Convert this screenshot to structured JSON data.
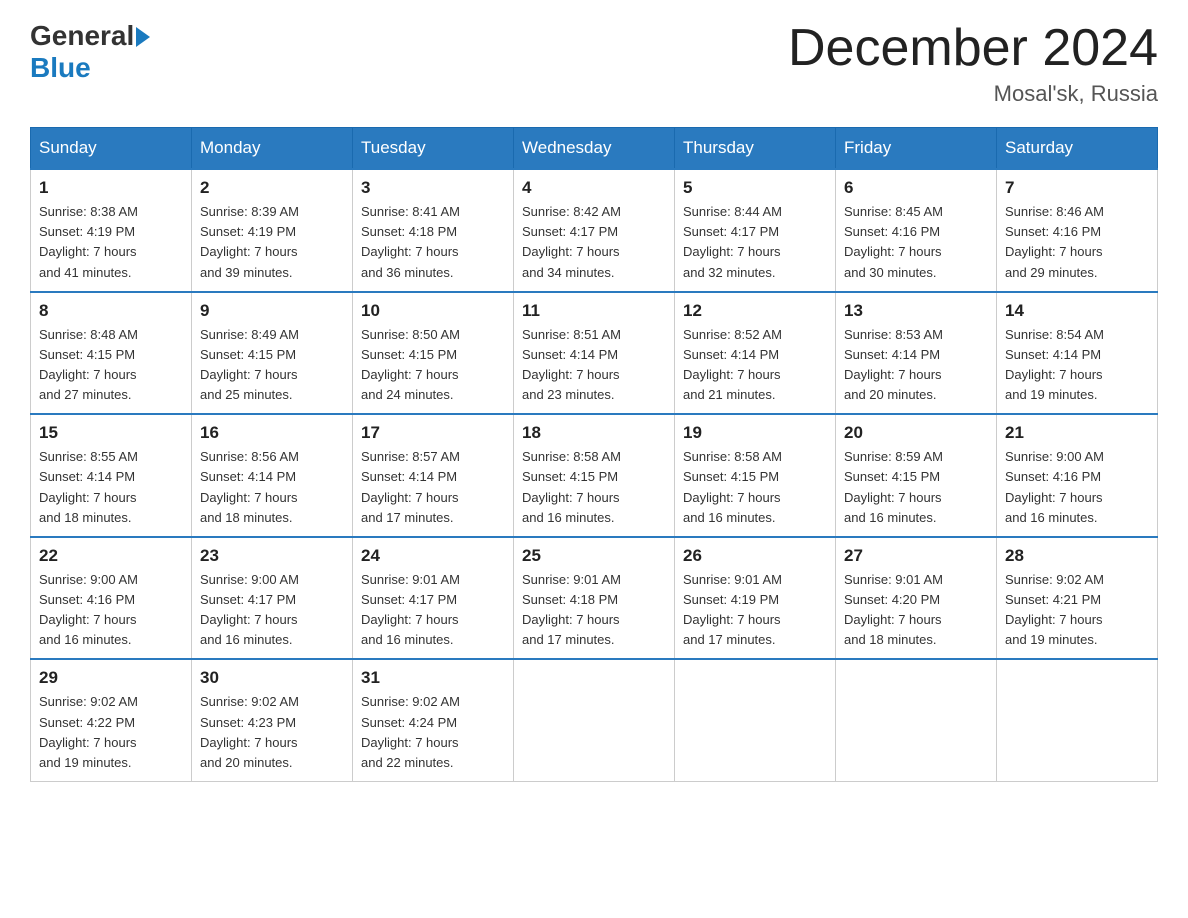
{
  "logo": {
    "general": "General",
    "blue": "Blue"
  },
  "title": "December 2024",
  "location": "Mosal'sk, Russia",
  "weekdays": [
    "Sunday",
    "Monday",
    "Tuesday",
    "Wednesday",
    "Thursday",
    "Friday",
    "Saturday"
  ],
  "weeks": [
    [
      {
        "day": "1",
        "sunrise": "8:38 AM",
        "sunset": "4:19 PM",
        "daylight": "7 hours and 41 minutes."
      },
      {
        "day": "2",
        "sunrise": "8:39 AM",
        "sunset": "4:19 PM",
        "daylight": "7 hours and 39 minutes."
      },
      {
        "day": "3",
        "sunrise": "8:41 AM",
        "sunset": "4:18 PM",
        "daylight": "7 hours and 36 minutes."
      },
      {
        "day": "4",
        "sunrise": "8:42 AM",
        "sunset": "4:17 PM",
        "daylight": "7 hours and 34 minutes."
      },
      {
        "day": "5",
        "sunrise": "8:44 AM",
        "sunset": "4:17 PM",
        "daylight": "7 hours and 32 minutes."
      },
      {
        "day": "6",
        "sunrise": "8:45 AM",
        "sunset": "4:16 PM",
        "daylight": "7 hours and 30 minutes."
      },
      {
        "day": "7",
        "sunrise": "8:46 AM",
        "sunset": "4:16 PM",
        "daylight": "7 hours and 29 minutes."
      }
    ],
    [
      {
        "day": "8",
        "sunrise": "8:48 AM",
        "sunset": "4:15 PM",
        "daylight": "7 hours and 27 minutes."
      },
      {
        "day": "9",
        "sunrise": "8:49 AM",
        "sunset": "4:15 PM",
        "daylight": "7 hours and 25 minutes."
      },
      {
        "day": "10",
        "sunrise": "8:50 AM",
        "sunset": "4:15 PM",
        "daylight": "7 hours and 24 minutes."
      },
      {
        "day": "11",
        "sunrise": "8:51 AM",
        "sunset": "4:14 PM",
        "daylight": "7 hours and 23 minutes."
      },
      {
        "day": "12",
        "sunrise": "8:52 AM",
        "sunset": "4:14 PM",
        "daylight": "7 hours and 21 minutes."
      },
      {
        "day": "13",
        "sunrise": "8:53 AM",
        "sunset": "4:14 PM",
        "daylight": "7 hours and 20 minutes."
      },
      {
        "day": "14",
        "sunrise": "8:54 AM",
        "sunset": "4:14 PM",
        "daylight": "7 hours and 19 minutes."
      }
    ],
    [
      {
        "day": "15",
        "sunrise": "8:55 AM",
        "sunset": "4:14 PM",
        "daylight": "7 hours and 18 minutes."
      },
      {
        "day": "16",
        "sunrise": "8:56 AM",
        "sunset": "4:14 PM",
        "daylight": "7 hours and 18 minutes."
      },
      {
        "day": "17",
        "sunrise": "8:57 AM",
        "sunset": "4:14 PM",
        "daylight": "7 hours and 17 minutes."
      },
      {
        "day": "18",
        "sunrise": "8:58 AM",
        "sunset": "4:15 PM",
        "daylight": "7 hours and 16 minutes."
      },
      {
        "day": "19",
        "sunrise": "8:58 AM",
        "sunset": "4:15 PM",
        "daylight": "7 hours and 16 minutes."
      },
      {
        "day": "20",
        "sunrise": "8:59 AM",
        "sunset": "4:15 PM",
        "daylight": "7 hours and 16 minutes."
      },
      {
        "day": "21",
        "sunrise": "9:00 AM",
        "sunset": "4:16 PM",
        "daylight": "7 hours and 16 minutes."
      }
    ],
    [
      {
        "day": "22",
        "sunrise": "9:00 AM",
        "sunset": "4:16 PM",
        "daylight": "7 hours and 16 minutes."
      },
      {
        "day": "23",
        "sunrise": "9:00 AM",
        "sunset": "4:17 PM",
        "daylight": "7 hours and 16 minutes."
      },
      {
        "day": "24",
        "sunrise": "9:01 AM",
        "sunset": "4:17 PM",
        "daylight": "7 hours and 16 minutes."
      },
      {
        "day": "25",
        "sunrise": "9:01 AM",
        "sunset": "4:18 PM",
        "daylight": "7 hours and 17 minutes."
      },
      {
        "day": "26",
        "sunrise": "9:01 AM",
        "sunset": "4:19 PM",
        "daylight": "7 hours and 17 minutes."
      },
      {
        "day": "27",
        "sunrise": "9:01 AM",
        "sunset": "4:20 PM",
        "daylight": "7 hours and 18 minutes."
      },
      {
        "day": "28",
        "sunrise": "9:02 AM",
        "sunset": "4:21 PM",
        "daylight": "7 hours and 19 minutes."
      }
    ],
    [
      {
        "day": "29",
        "sunrise": "9:02 AM",
        "sunset": "4:22 PM",
        "daylight": "7 hours and 19 minutes."
      },
      {
        "day": "30",
        "sunrise": "9:02 AM",
        "sunset": "4:23 PM",
        "daylight": "7 hours and 20 minutes."
      },
      {
        "day": "31",
        "sunrise": "9:02 AM",
        "sunset": "4:24 PM",
        "daylight": "7 hours and 22 minutes."
      },
      null,
      null,
      null,
      null
    ]
  ],
  "labels": {
    "sunrise": "Sunrise:",
    "sunset": "Sunset:",
    "daylight": "Daylight:"
  }
}
